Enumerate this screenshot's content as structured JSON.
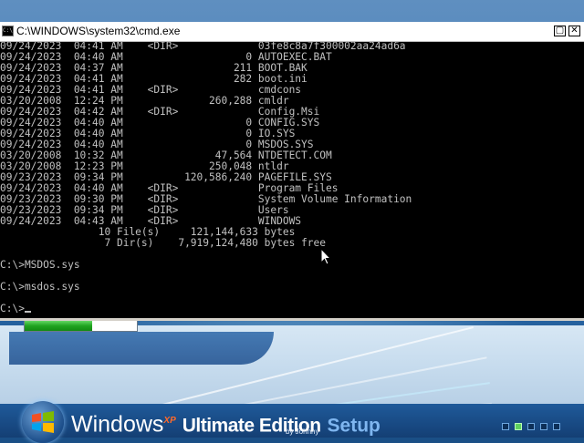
{
  "setup_screen": {
    "title_windows": "Windows",
    "title_xp": "XP",
    "title_edition": "Ultimate Edition",
    "title_setup": "Setup",
    "byline": "by Johnny",
    "progress_fraction": 0.6,
    "step_indicators": 5,
    "active_step": 2,
    "colors": {
      "progress": "#1fa31f",
      "band": "#c7dcee",
      "accent": "#7fb6f0"
    }
  },
  "cmd_window": {
    "title": "C:\\WINDOWS\\system32\\cmd.exe",
    "icon": "console-app-icon",
    "controls": [
      "minimize",
      "close"
    ],
    "listing": [
      {
        "date": "09/24/2023",
        "time": "04:41 AM",
        "type": "<DIR>",
        "size": "",
        "name": "03fe8c8a7f300002aa24ad6a"
      },
      {
        "date": "09/24/2023",
        "time": "04:40 AM",
        "type": "",
        "size": "0",
        "name": "AUTOEXEC.BAT"
      },
      {
        "date": "09/24/2023",
        "time": "04:37 AM",
        "type": "",
        "size": "211",
        "name": "BOOT.BAK"
      },
      {
        "date": "09/24/2023",
        "time": "04:41 AM",
        "type": "",
        "size": "282",
        "name": "boot.ini"
      },
      {
        "date": "09/24/2023",
        "time": "04:41 AM",
        "type": "<DIR>",
        "size": "",
        "name": "cmdcons"
      },
      {
        "date": "03/20/2008",
        "time": "12:24 PM",
        "type": "",
        "size": "260,288",
        "name": "cmldr"
      },
      {
        "date": "09/24/2023",
        "time": "04:42 AM",
        "type": "<DIR>",
        "size": "",
        "name": "Config.Msi"
      },
      {
        "date": "09/24/2023",
        "time": "04:40 AM",
        "type": "",
        "size": "0",
        "name": "CONFIG.SYS"
      },
      {
        "date": "09/24/2023",
        "time": "04:40 AM",
        "type": "",
        "size": "0",
        "name": "IO.SYS"
      },
      {
        "date": "09/24/2023",
        "time": "04:40 AM",
        "type": "",
        "size": "0",
        "name": "MSDOS.SYS"
      },
      {
        "date": "03/20/2008",
        "time": "10:32 AM",
        "type": "",
        "size": "47,564",
        "name": "NTDETECT.COM"
      },
      {
        "date": "03/20/2008",
        "time": "12:23 PM",
        "type": "",
        "size": "250,048",
        "name": "ntldr"
      },
      {
        "date": "09/23/2023",
        "time": "09:34 PM",
        "type": "",
        "size": "120,586,240",
        "name": "PAGEFILE.SYS"
      },
      {
        "date": "09/24/2023",
        "time": "04:40 AM",
        "type": "<DIR>",
        "size": "",
        "name": "Program Files"
      },
      {
        "date": "09/23/2023",
        "time": "09:30 PM",
        "type": "<DIR>",
        "size": "",
        "name": "System Volume Information"
      },
      {
        "date": "09/23/2023",
        "time": "09:34 PM",
        "type": "<DIR>",
        "size": "",
        "name": "Users"
      },
      {
        "date": "09/24/2023",
        "time": "04:43 AM",
        "type": "<DIR>",
        "size": "",
        "name": "WINDOWS"
      }
    ],
    "summary": [
      {
        "count": "10",
        "label": "File(s)",
        "amount": "121,144,633",
        "unit": "bytes"
      },
      {
        "count": "7",
        "label": "Dir(s)",
        "amount": "7,919,124,480",
        "unit": "bytes free"
      }
    ],
    "commands": [
      {
        "prompt": "C:\\>",
        "text": "MSDOS.sys"
      },
      {
        "prompt": "C:\\>",
        "text": "msdos.sys"
      }
    ],
    "current_prompt": "C:\\>"
  }
}
